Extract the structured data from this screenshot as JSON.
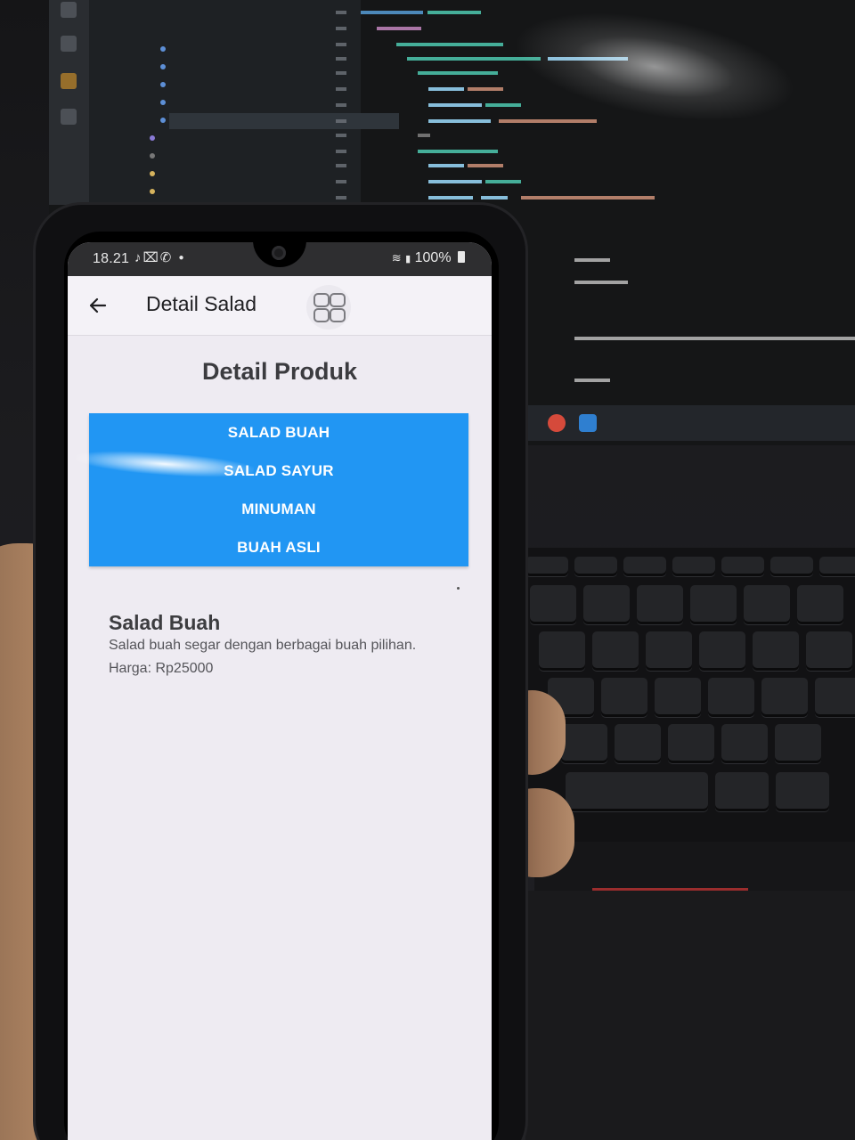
{
  "status_bar": {
    "time": "18.21",
    "notification_icons": [
      "tiktok-icon",
      "capcut-icon",
      "whatsapp-icon",
      "dot"
    ],
    "battery": "100%"
  },
  "header": {
    "title": "Detail Salad",
    "back_icon": "arrow-left-icon",
    "menu_icon": "grid-icon"
  },
  "page": {
    "title": "Detail Produk"
  },
  "menu": {
    "color": "#2196f3",
    "items": [
      {
        "label": "SALAD BUAH"
      },
      {
        "label": "SALAD SAYUR"
      },
      {
        "label": "MINUMAN"
      },
      {
        "label": "BUAH ASLI"
      }
    ]
  },
  "product": {
    "name": "Salad Buah",
    "description": "Salad buah segar dengan berbagai buah pilihan.",
    "price": "Harga: Rp25000"
  }
}
